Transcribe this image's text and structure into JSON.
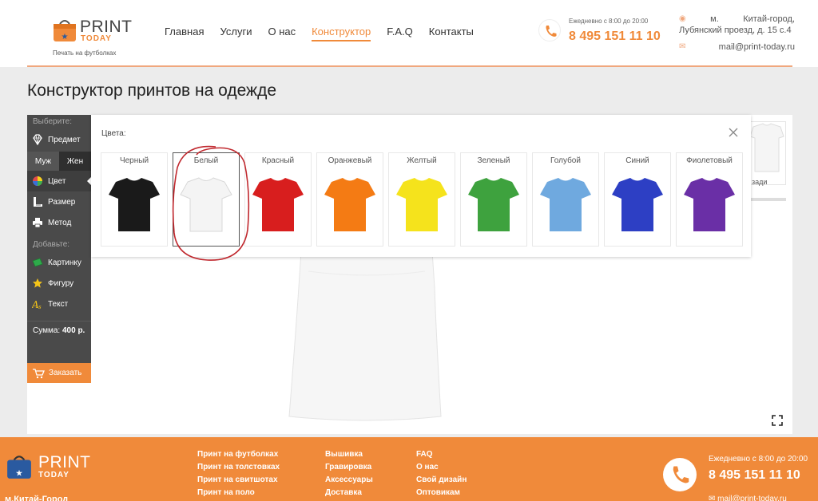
{
  "header": {
    "logo_print": "PRINT",
    "logo_today": "TODAY",
    "logo_tagline": "Печать на футболках",
    "nav": [
      "Главная",
      "Услуги",
      "О нас",
      "Конструктор",
      "F.A.Q",
      "Контакты"
    ],
    "nav_active": "Конструктор",
    "hours": "Ежедневно с 8:00 до 20:00",
    "phone": "8 495 151 11 10",
    "address_metro": "м.",
    "address_station": "Китай-город,",
    "address_street": "Лубянский проезд, д. 15 с.4",
    "email": "mail@print-today.ru"
  },
  "page": {
    "title": "Конструктор принтов на одежде"
  },
  "sidebar": {
    "choose_label": "Выберите:",
    "product": "Предмет",
    "gender_male": "Муж",
    "gender_female": "Жен",
    "color": "Цвет",
    "size": "Размер",
    "method": "Метод",
    "add_label": "Добавьте:",
    "picture": "Картинку",
    "figure": "Фигуру",
    "text": "Текст",
    "sum_label": "Сумма:",
    "sum_value": "400 р.",
    "order": "Заказать"
  },
  "color_popup": {
    "label": "Цвета:",
    "colors": [
      {
        "name": "Черный",
        "hex": "#1a1a1a"
      },
      {
        "name": "Белый",
        "hex": "#f4f4f4"
      },
      {
        "name": "Красный",
        "hex": "#d81e1e"
      },
      {
        "name": "Оранжевый",
        "hex": "#f47b14"
      },
      {
        "name": "Желтый",
        "hex": "#f5e31c"
      },
      {
        "name": "Зеленый",
        "hex": "#3ea23e"
      },
      {
        "name": "Голубой",
        "hex": "#6fa9df"
      },
      {
        "name": "Синий",
        "hex": "#2d3fc4"
      },
      {
        "name": "Фиолетовый",
        "hex": "#6a2fa6"
      }
    ],
    "selected": "Белый"
  },
  "right_thumb_label": "зади",
  "footer": {
    "logo_print": "PRINT",
    "logo_today": "TODAY",
    "metro": "м.Китай-Город",
    "col1": [
      "Принт на футболках",
      "Принт на толстовках",
      "Принт на свитшотах",
      "Принт на поло"
    ],
    "col2": [
      "Вышивка",
      "Гравировка",
      "Аксессуары",
      "Доставка"
    ],
    "col3": [
      "FAQ",
      "О нас",
      "Свой дизайн",
      "Оптовикам"
    ],
    "hours": "Ежедневно с 8:00 до 20:00",
    "phone": "8 495 151 11 10",
    "email": "mail@print-today.ru"
  },
  "colors": {
    "accent": "#f08a3a",
    "sidebar_bg": "#4a4a4a",
    "annotation_red": "#c0282e"
  }
}
